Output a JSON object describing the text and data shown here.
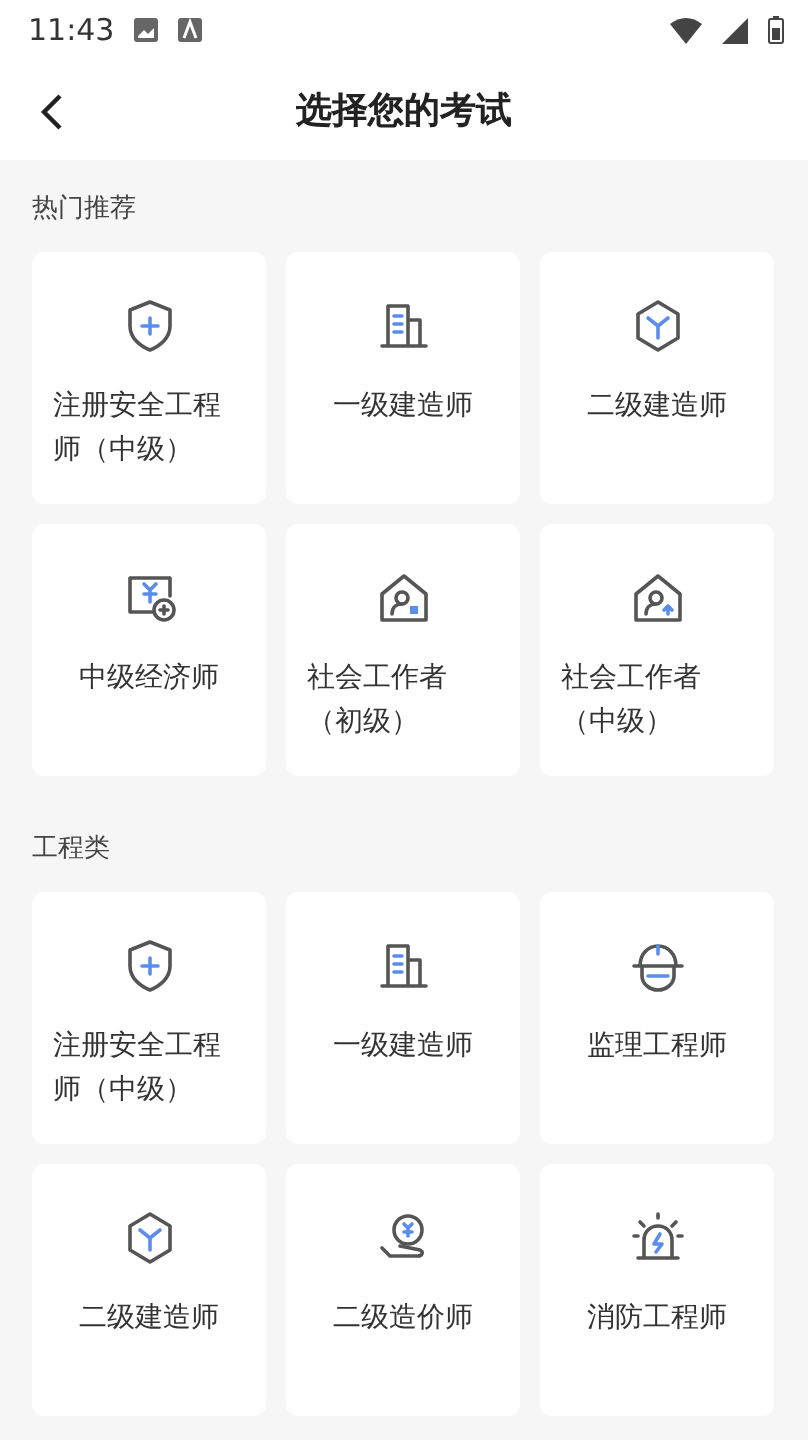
{
  "status_bar": {
    "time": "11:43"
  },
  "header": {
    "title": "选择您的考试"
  },
  "sections": [
    {
      "title": "热门推荐",
      "items": [
        {
          "label": "注册安全工程师（中级）",
          "kind": "shield"
        },
        {
          "label": "一级建造师",
          "kind": "building"
        },
        {
          "label": "二级建造师",
          "kind": "cube"
        },
        {
          "label": "中级经济师",
          "kind": "money"
        },
        {
          "label": "社会工作者（初级）",
          "kind": "house"
        },
        {
          "label": "社会工作者（中级）",
          "kind": "houseup"
        }
      ]
    },
    {
      "title": "工程类",
      "items": [
        {
          "label": "注册安全工程师（中级）",
          "kind": "shield"
        },
        {
          "label": "一级建造师",
          "kind": "building"
        },
        {
          "label": "监理工程师",
          "kind": "helmet"
        },
        {
          "label": "二级建造师",
          "kind": "cube"
        },
        {
          "label": "二级造价师",
          "kind": "coin"
        },
        {
          "label": "消防工程师",
          "kind": "alarm"
        }
      ]
    }
  ]
}
